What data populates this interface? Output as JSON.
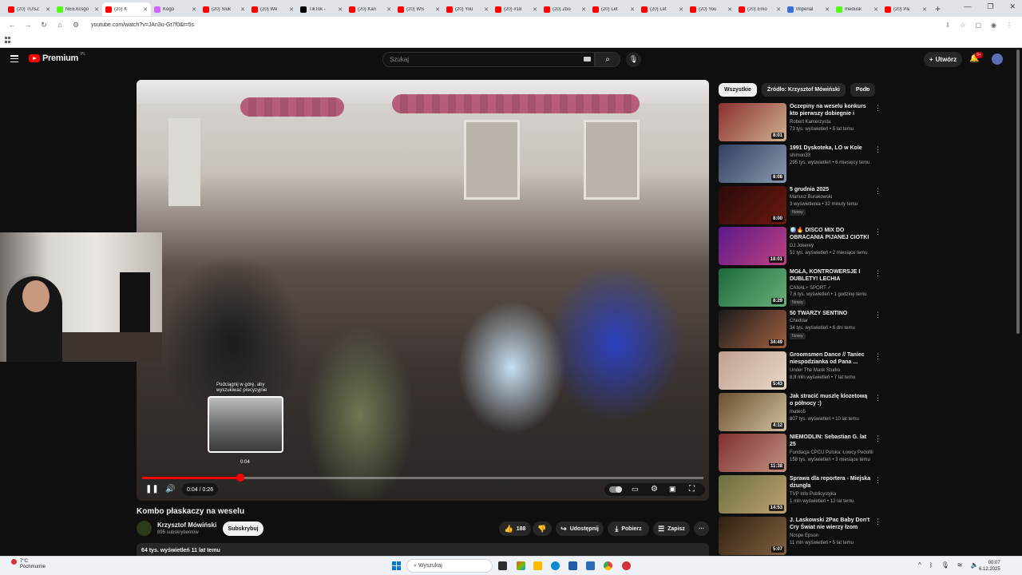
{
  "browser": {
    "tabs": [
      {
        "label": "(20) TUSZ",
        "color": "#ff0000"
      },
      {
        "label": "NEEXcsgo",
        "color": "#53fc18"
      },
      {
        "label": "(20) K",
        "color": "#ff0000",
        "active": true
      },
      {
        "label": "Kogo",
        "color": "#cc66ff"
      },
      {
        "label": "(20) Śluk",
        "color": "#ff0000"
      },
      {
        "label": "(20) We",
        "color": "#ff0000"
      },
      {
        "label": "TikTok -",
        "color": "#000000"
      },
      {
        "label": "(20) Kan",
        "color": "#ff0000"
      },
      {
        "label": "(20) WS",
        "color": "#ff0000"
      },
      {
        "label": "(20) You",
        "color": "#ff0000"
      },
      {
        "label": "(20) #18",
        "color": "#ff0000"
      },
      {
        "label": "(20) Zbo",
        "color": "#ff0000"
      },
      {
        "label": "(20) Let",
        "color": "#ff0000"
      },
      {
        "label": "(20) Let",
        "color": "#ff0000"
      },
      {
        "label": "(20) You",
        "color": "#ff0000"
      },
      {
        "label": "(20) Emo",
        "color": "#ff0000"
      },
      {
        "label": "Imperial",
        "color": "#3b6fd6"
      },
      {
        "label": "medusk",
        "color": "#53fc18"
      },
      {
        "label": "(20) P&",
        "color": "#ff0000"
      }
    ],
    "new_tab": "+",
    "url": "youtube.com/watch?v=JAn3u-Gt7f0&t=5s",
    "window_controls": [
      "—",
      "❐",
      "✕"
    ]
  },
  "header": {
    "logo_text": "Premium",
    "logo_country": "PL",
    "search_placeholder": "Szukaj",
    "create_label": "Utwórz",
    "notification_count": "9+"
  },
  "player": {
    "hover_tip": "Podciągnij w górę, aby wyszukiwać precyzyjnie",
    "hover_time": "0:04",
    "current_time": "0:04",
    "duration": "0:26",
    "time_display": "0:04 / 0:26",
    "progress": 0.175
  },
  "video": {
    "title": "Kombo płaskaczy na weselu",
    "channel_name": "Krzysztof Mówiński",
    "subscribers": "895 subskrybentów",
    "subscribe_label": "Subskrybuj",
    "likes": "188",
    "share_label": "Udostępnij",
    "download_label": "Pobierz",
    "save_label": "Zapisz",
    "views_date": "64 tys. wyświetleń  11 lat temu"
  },
  "sidebar": {
    "chips": [
      "Wszystkie",
      "Źródło: Krzysztof Mówiński",
      "Podo"
    ],
    "items": [
      {
        "title": "Oczepiny na weselu konkurs kto pierwszy dobiegnie i wypije ...",
        "channel": "Robert Kamerzysta",
        "meta": "73 tys. wyświetleń • 5 lat temu",
        "duration": "8:01",
        "badge": "",
        "c1": "#8a2f2f",
        "c2": "#d0b090"
      },
      {
        "title": "1991 Dyskoteka, LO w Kole",
        "channel": "shimon33",
        "meta": "295 tys. wyświetleń • 6 miesięcy temu",
        "duration": "8:08",
        "badge": "",
        "c1": "#304060",
        "c2": "#8a9ab0"
      },
      {
        "title": "5 grudnia 2025",
        "channel": "Mariusz Burakowski",
        "meta": "3 wyświetlenia • 32 minuty temu",
        "duration": "8:00",
        "badge": "Nowy",
        "c1": "#2a0a0a",
        "c2": "#6a1a10"
      },
      {
        "title": "🪩🔥 DISCO MIX DO OBRACANIA PIJANEJ CIOTKI ...",
        "channel": "DJ Jokerey",
        "meta": "51 tys. wyświetleń • 2 miesiące temu",
        "duration": "18:01",
        "badge": "",
        "c1": "#5a1a8a",
        "c2": "#c04080"
      },
      {
        "title": "MGŁA, KONTROWERSJE I DUBLETY! LECHIA DEKLASUJ...",
        "channel": "CANAL+ SPORT ✓",
        "meta": "7,6 tys. wyświetleń • 1 godzinę temu",
        "duration": "8:29",
        "badge": "Nowy",
        "c1": "#1a6a3a",
        "c2": "#6ab07a"
      },
      {
        "title": "50 TWARZY SENTINO",
        "channel": "Cheddar",
        "meta": "34 tys. wyświetleń • 6 dni temu",
        "duration": "34:49",
        "badge": "Nowy",
        "c1": "#1a1a1a",
        "c2": "#a06040"
      },
      {
        "title": "Groomsmen Dance // Taniec niespodzianka od Pana ...",
        "channel": "Under The Mask Studio",
        "meta": "8,8 mln wyświetleń • 7 lat temu",
        "duration": "5:43",
        "badge": "",
        "c1": "#c0a090",
        "c2": "#e8d8c8"
      },
      {
        "title": "Jak stracić muszlę klozetową o północy :)",
        "channel": "mateo5",
        "meta": "807 tys. wyświetleń • 10 lat temu",
        "duration": "4:12",
        "badge": "",
        "c1": "#6a5030",
        "c2": "#d0c0a0"
      },
      {
        "title": "NIEMODLIN: Sebastian G. lat 25",
        "channel": "Fundacja CPCU Polska: Łowcy Pedofili",
        "meta": "158 tys. wyświetleń • 3 miesiące temu",
        "duration": "11:38",
        "badge": "",
        "c1": "#803030",
        "c2": "#c09080"
      },
      {
        "title": "Sprawa dla reportera - Miejska dżungla",
        "channel": "TVP Info Publicystyka",
        "meta": "1 mln wyświetleń • 12 lat temu",
        "duration": "14:53",
        "badge": "",
        "c1": "#6a7040",
        "c2": "#c0a070"
      },
      {
        "title": "J. Laskowski  2Pac Baby Don't Cry Świat nie wierzy łzom",
        "channel": "Nospe Epson",
        "meta": "11 mln wyświetleń • 5 lat temu",
        "duration": "5:07",
        "badge": "",
        "c1": "#302010",
        "c2": "#806040"
      }
    ]
  },
  "taskbar": {
    "temp": "7°C",
    "weather": "Pochmurnie",
    "search_placeholder": "Wyszukaj",
    "time": "00:07",
    "date": "6.12.2025",
    "weather_badge": "4"
  }
}
